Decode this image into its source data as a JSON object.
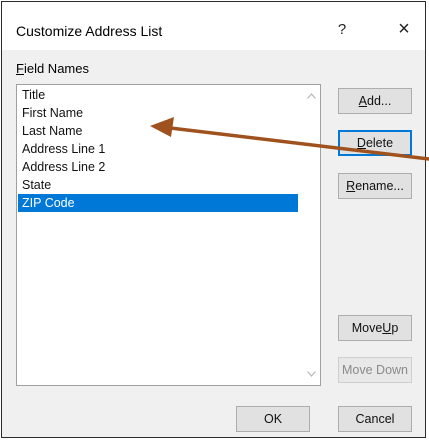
{
  "window": {
    "title": "Customize Address List",
    "help_glyph": "?",
    "close_glyph": "×"
  },
  "field_names": {
    "label_accel": "F",
    "label_rest": "ield Names",
    "items": [
      "Title",
      "First Name",
      "Last Name",
      "Address Line 1",
      "Address Line 2",
      "State",
      "ZIP Code"
    ],
    "selected": "ZIP Code"
  },
  "buttons": {
    "add": {
      "pre": "",
      "acc": "A",
      "post": "dd..."
    },
    "delete": {
      "pre": "",
      "acc": "D",
      "post": "elete"
    },
    "rename": {
      "pre": "",
      "acc": "R",
      "post": "ename..."
    },
    "move_up": {
      "pre": "Move ",
      "acc": "U",
      "post": "p"
    },
    "move_down": {
      "label": "Move Down"
    },
    "ok": "OK",
    "cancel": "Cancel"
  },
  "colors": {
    "selection": "#0078d7",
    "annotation_arrow": "#a0521e"
  },
  "icons": {
    "scroll_up": "chevron-up-icon",
    "scroll_down": "chevron-down-icon"
  }
}
